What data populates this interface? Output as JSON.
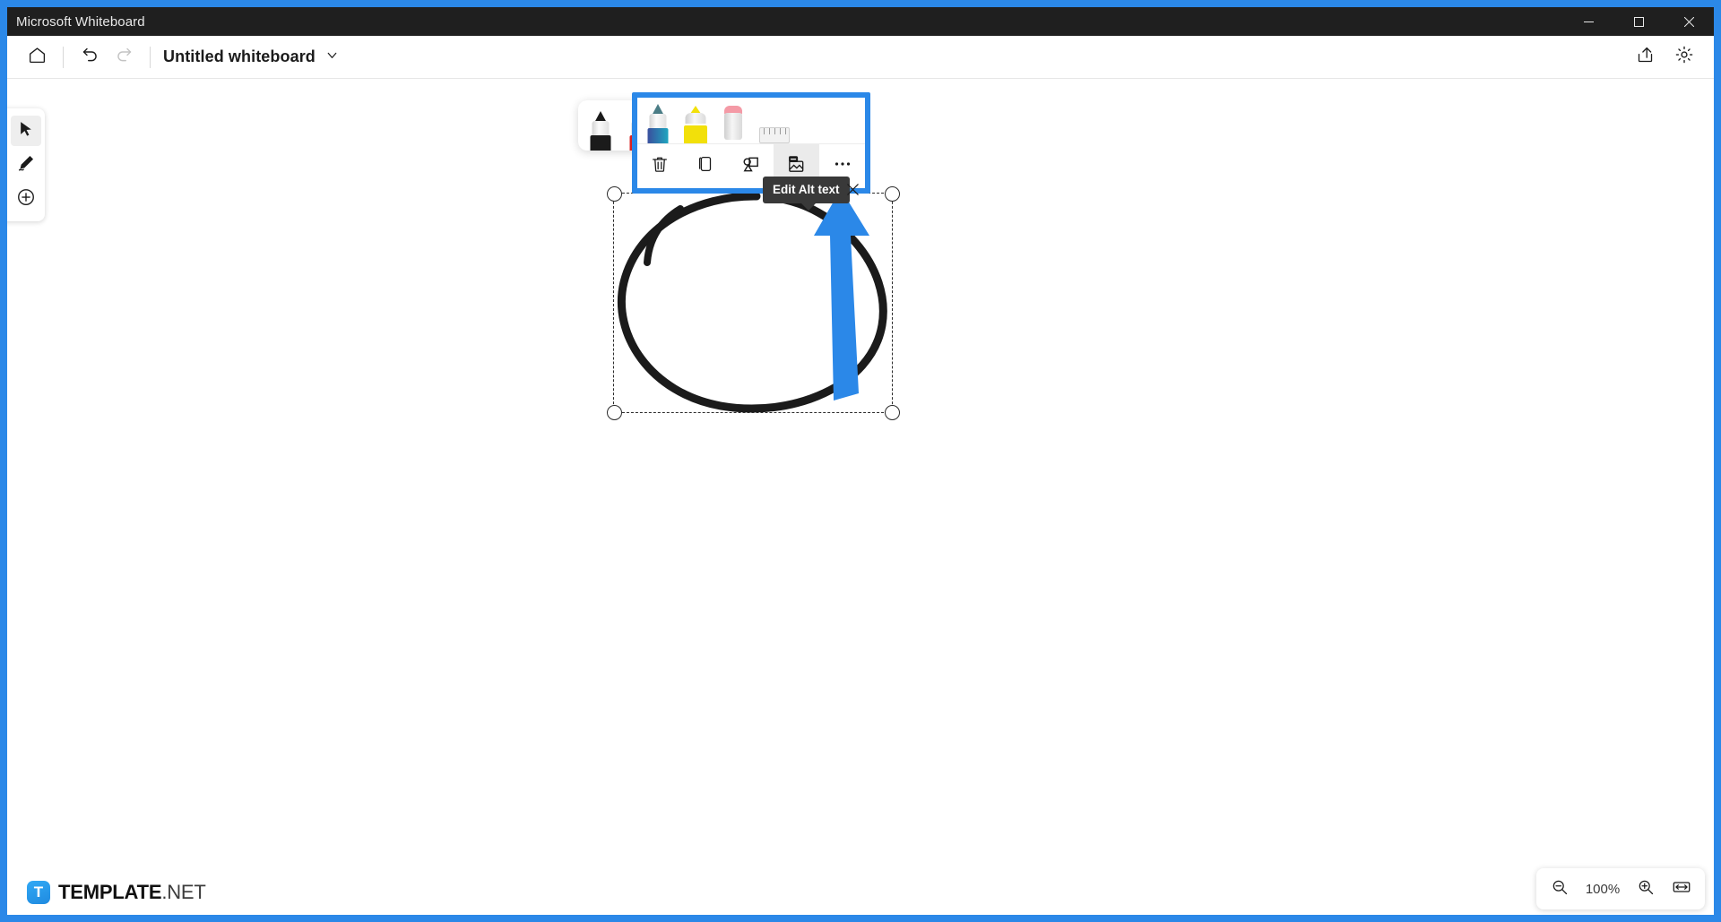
{
  "window": {
    "title": "Microsoft Whiteboard",
    "controls": [
      {
        "name": "minimize",
        "icon": "minimize-icon"
      },
      {
        "name": "maximize",
        "icon": "maximize-icon"
      },
      {
        "name": "close",
        "icon": "close-icon"
      }
    ]
  },
  "command_bar": {
    "home_icon": "home-icon",
    "undo_icon": "undo-icon",
    "redo_icon": "redo-icon",
    "board_title": "Untitled whiteboard",
    "title_chevron_icon": "chevron-down-icon",
    "share_icon": "share-icon",
    "settings_icon": "gear-icon"
  },
  "tool_rail": {
    "items": [
      {
        "label": "Select",
        "icon": "cursor-arrow-icon",
        "active": true
      },
      {
        "label": "Inking",
        "icon": "pen-icon",
        "active": false
      },
      {
        "label": "Create",
        "icon": "plus-circle-icon",
        "active": false
      }
    ]
  },
  "pen_toolbar": {
    "pens": [
      {
        "label": "Black pen",
        "color": "#1b1b1b",
        "type": "pen"
      },
      {
        "label": "Red pen",
        "color": "#d92121",
        "type": "pen"
      }
    ]
  },
  "context_toolbar": {
    "pens": [
      {
        "label": "Blue pen",
        "color": "#3a4f9e",
        "type": "pen"
      },
      {
        "label": "Yellow highlighter",
        "color": "#f2e00a",
        "type": "highlighter"
      },
      {
        "label": "Eraser",
        "color": "#f49aa6",
        "type": "eraser"
      },
      {
        "label": "Ruler",
        "color": "#cfcfcf",
        "type": "ruler"
      }
    ],
    "actions": [
      {
        "label": "Delete",
        "icon": "trash-icon",
        "selected": false
      },
      {
        "label": "Duplicate",
        "icon": "duplicate-icon",
        "selected": false
      },
      {
        "label": "Ink to shape",
        "icon": "ink-to-shape-icon",
        "selected": false
      },
      {
        "label": "Edit Alt text",
        "icon": "alt-text-image-icon",
        "selected": true
      },
      {
        "label": "More options",
        "icon": "more-horizontal-icon",
        "selected": false
      }
    ]
  },
  "tooltip": {
    "text": "Edit Alt text",
    "close_icon": "close-icon"
  },
  "selection": {
    "handles": [
      "top-left",
      "top-right",
      "bottom-left",
      "bottom-right"
    ],
    "ink_stroke_color": "#1b1b1b"
  },
  "annotation": {
    "arrow_color": "#2b88e8",
    "direction": "up"
  },
  "zoom_bar": {
    "zoom_out_icon": "zoom-out-icon",
    "level": "100%",
    "zoom_in_icon": "zoom-in-icon",
    "fit_icon": "fit-to-width-icon"
  },
  "watermark": {
    "logo_letter": "T",
    "name_bold": "TEMPLATE",
    "name_light": ".NET"
  },
  "colors": {
    "accent_blue": "#2b88e8",
    "titlebar_bg": "#1f1f1f",
    "tooltip_bg": "#393939"
  }
}
